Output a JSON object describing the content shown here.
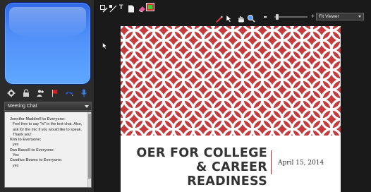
{
  "chat": {
    "header": "Meeting Chat",
    "messages": [
      {
        "sender": "Jennifer Maddrell to Everyone:",
        "text": "Feel free to say \"hi\" in the text-chat. Also, ask for the mic if you would like to speak. Thank you!"
      },
      {
        "sender": "Kim to Everyone:",
        "text": "yes"
      },
      {
        "sender": "Dan Bassill to Everyone:",
        "text": "Yes"
      },
      {
        "sender": "Candice Bowes to Everyone:",
        "text": "yes"
      }
    ]
  },
  "viewer": {
    "zoom_select": "Fit Viewer"
  },
  "slide": {
    "title_line1": "OER FOR COLLEGE",
    "title_line2": "& CAREER READINESS",
    "date": "April 15, 2014"
  },
  "colors": {
    "slide_pattern_red": "#c43a3d",
    "video_blue": "#4f8ff8"
  },
  "icons": {
    "left_bar": [
      "gear-icon",
      "lock-icon",
      "add-user-icon",
      "flag-icon",
      "phone-icon",
      "microphone-icon"
    ],
    "top_bar": [
      "draw-tools-icon",
      "line-icon",
      "text-icon",
      "page-icon",
      "eraser-icon",
      "color-picker-icon"
    ],
    "viewer_bar": [
      "pen-icon",
      "pointer-icon",
      "hand-icon",
      "zoom-icon"
    ]
  }
}
